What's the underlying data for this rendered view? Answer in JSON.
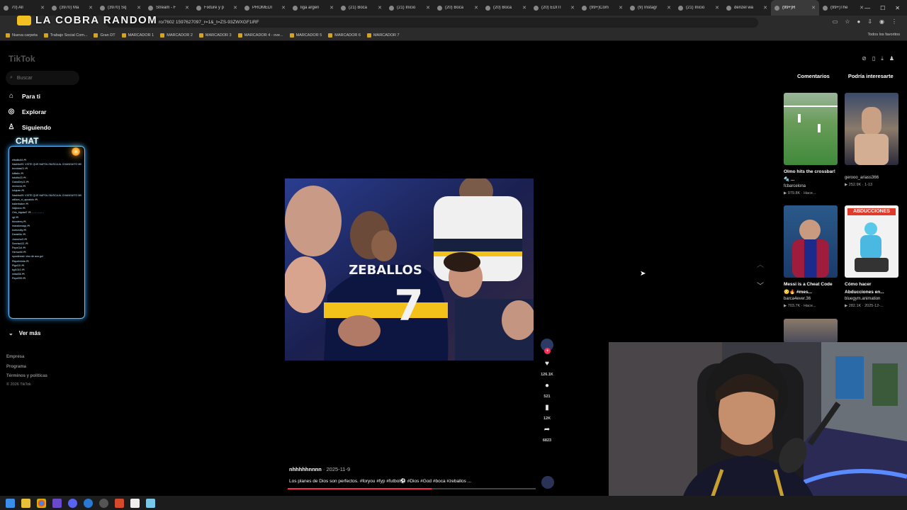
{
  "browser": {
    "tabs": [
      {
        "title": "70) All"
      },
      {
        "title": "(3970) Ma"
      },
      {
        "title": "(3970) Sq"
      },
      {
        "title": "Stream - F"
      },
      {
        "title": "Fixture y p"
      },
      {
        "title": "PROMEDI"
      },
      {
        "title": "liga argen"
      },
      {
        "title": "(21) Boca"
      },
      {
        "title": "(21) Inicio"
      },
      {
        "title": "(20) Boca"
      },
      {
        "title": "(20) Boca"
      },
      {
        "title": "(20) EDITI"
      },
      {
        "title": "(99+)Cóm"
      },
      {
        "title": "(9) Instagr"
      },
      {
        "title": "(21) Inicio"
      },
      {
        "title": "denzel wa"
      },
      {
        "title": "(99+)R"
      },
      {
        "title": "(99+)The"
      }
    ],
    "url": "ro/7602 1597627097_r=1&_t=ZS-93ZWXGF1iRF",
    "bookmarks": [
      "Nueva carpeta",
      "Trabajo Social Com...",
      "Gran DT",
      "MARCADOR 1",
      "MARCADOR 2",
      "MARCADOR 3",
      "MARCADOR 4 - ove...",
      "MARCADOR 5",
      "MARCADOR 6",
      "MARCADOR 7"
    ],
    "all_bookmarks": "Todos los favoritos"
  },
  "stream_overlay": {
    "title": "LA COBRA RANDOM"
  },
  "tiktok": {
    "logo": "TikTok",
    "search_placeholder": "Buscar",
    "nav": [
      {
        "label": "Para ti",
        "icon": "home-icon"
      },
      {
        "label": "Explorar",
        "icon": "compass-icon"
      },
      {
        "label": "Siguiendo",
        "icon": "person-icon"
      }
    ],
    "chat_title": "CHAT",
    "ver_mas": "Ver más",
    "footer": [
      "Empresa",
      "Programa",
      "Términos y políticas"
    ],
    "copyright": "© 2026 TikTok",
    "right_tabs": [
      "Comentarios",
      "Podría interesarte"
    ],
    "video": {
      "jersey_name": "ZEBALLOS",
      "jersey_number": "7",
      "author": "nhhhhhnnnn",
      "date": "2025-11-9",
      "description": "Los planes de Dios son perfectos. #foryou #fyp #futbol⚽ #Dios #God #boca #zeballos ...",
      "progress": 0.58
    },
    "actions": [
      {
        "name": "like",
        "icon": "heart-icon",
        "count": "126.1K"
      },
      {
        "name": "comment",
        "icon": "comment-icon",
        "count": "521"
      },
      {
        "name": "save",
        "icon": "bookmark-icon",
        "count": "12K"
      },
      {
        "name": "share",
        "icon": "share-icon",
        "count": "6823"
      }
    ],
    "recommended": [
      {
        "title": "Olmo hits the crossbar! 🔩 ...",
        "author": "fcbarcelona",
        "stats": "▶ 979.8K · Hace..."
      },
      {
        "title": "",
        "author": "gerooo_ariass366",
        "stats": "▶ 252.9K · 1-13"
      },
      {
        "title": "Messi is a Cheat Code 😳🔥 #mes...",
        "author": "barca4ever.36",
        "stats": "▶ 703.7K · Hace..."
      },
      {
        "title": "Cómo hacer Abducciones en...",
        "author": "bluegym.animation",
        "stats": "▶ 282.1K · 2025-12-..."
      }
    ],
    "thumb_overlay": "ABDUCCIONES"
  },
  "chat_messages": [
    "elbalito44 🎮",
    "Nachito09: VISTE QUE NAPOLI BUSCA AL CHANGUITO MINE",
    "leonidas21 🎮",
    "lolitalio 🎮",
    "tototito33 🎮",
    "GabaDey11 🎮",
    "mxmxmx 🎮",
    "lulujuan 🎮",
    "Nachito09: VISTE QUE NAPOLI BUSCA AL CHANGUITO MINE",
    "william_xi_apostolo 🎮",
    "bakerbaker 🎮",
    "Nejinexx 🎮",
    "Orlo_bigdad7 🎮 - - - - - - - -",
    "rgf 🎮",
    "blondeeq 🎮",
    "maradonaqq 🎮",
    "bobsmitty 🎮",
    "Danielito 🎮",
    "JuanchoG 🎮",
    "Sonrisa111 🎮",
    "PepeGol 🎮",
    "HernanM 🎮",
    "spockhead: vino de aca gol",
    "Riquelmista 🎮",
    "Pigol10 🎮",
    "kgl1010 🎮",
    "mitad36 🎮",
    "Pepe999 🎮"
  ]
}
